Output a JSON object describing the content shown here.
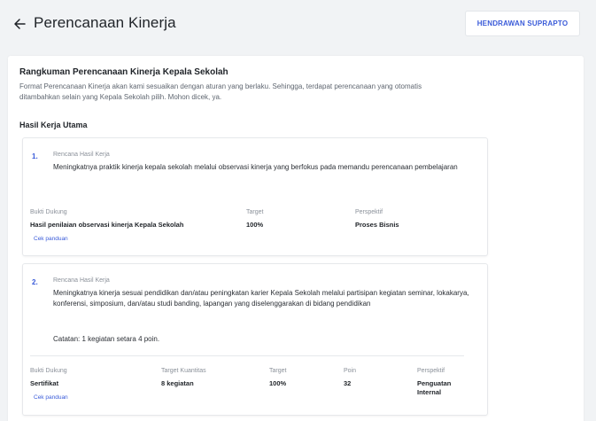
{
  "header": {
    "title": "Perencanaan Kinerja",
    "user_name": "HENDRAWAN SUPRAPTO"
  },
  "summary": {
    "title": "Rangkuman Perencanaan Kinerja Kepala Sekolah",
    "description": "Format Perencanaan Kinerja akan kami sesuaikan dengan aturan yang berlaku. Sehingga, terdapat perencanaan yang otomatis ditambahkan selain yang Kepala Sekolah pilih. Mohon dicek, ya."
  },
  "section": {
    "title": "Hasil Kerja Utama"
  },
  "items": [
    {
      "number": "1.",
      "rhk_label": "Rencana Hasil Kerja",
      "rhk_text": "Meningkatnya praktik kinerja kepala sekolah melalui observasi kinerja yang berfokus pada memandu perencanaan pembelajaran",
      "evidence_label": "Bukti Dukung",
      "evidence_value": "Hasil penilaian observasi kinerja Kepala Sekolah",
      "target_label": "Target",
      "target_value": "100%",
      "perspective_label": "Perspektif",
      "perspective_value": "Proses Bisnis",
      "guide_link": "Cek panduan"
    },
    {
      "number": "2.",
      "rhk_label": "Rencana Hasil Kerja",
      "rhk_text": "Meningkatnya kinerja sesuai pendidikan dan/atau peningkatan karier Kepala Sekolah melalui partisipan kegiatan seminar, lokakarya, konferensi, simposium, dan/atau studi banding, lapangan yang diselenggarakan di bidang pendidikan",
      "note": "Catatan: 1 kegiatan setara 4 poin.",
      "evidence_label": "Bukti Dukung",
      "evidence_value": "Sertifikat",
      "qty_target_label": "Target Kuantitas",
      "qty_target_value": "8 kegiatan",
      "target_label": "Target",
      "target_value": "100%",
      "points_label": "Poin",
      "points_value": "32",
      "perspective_label": "Perspektif",
      "perspective_value": "Penguatan Internal",
      "guide_link": "Cek panduan"
    }
  ]
}
